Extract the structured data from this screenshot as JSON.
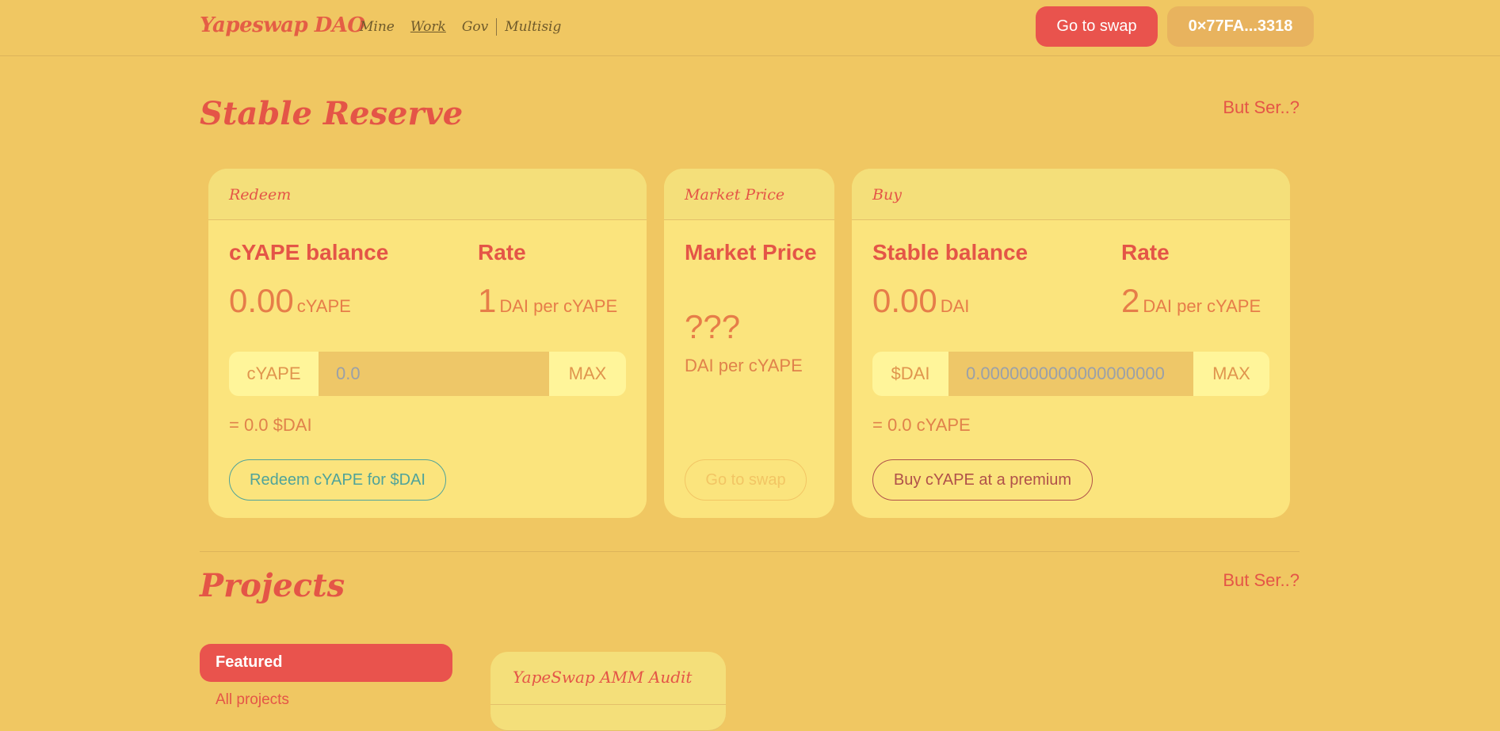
{
  "header": {
    "brand": "Yapeswap DAO",
    "nav": [
      "Mine",
      "Work",
      "Gov",
      "Multisig"
    ],
    "active_nav": "Work",
    "swap_button": "Go to swap",
    "wallet": "0×77FA...3318"
  },
  "stable_reserve": {
    "title": "Stable Reserve",
    "but_ser": "But Ser..?",
    "redeem": {
      "header": "Redeem",
      "balance_label": "cYAPE balance",
      "balance_value": "0.00",
      "balance_unit": "cYAPE",
      "rate_label": "Rate",
      "rate_value": "1",
      "rate_unit": "DAI per cYAPE",
      "input_prefix": "cYAPE",
      "input_value": "0.0",
      "input_max": "MAX",
      "equals": "= 0.0 $DAI",
      "action": "Redeem cYAPE for $DAI"
    },
    "market": {
      "header": "Market Price",
      "label": "Market Price",
      "value": "???",
      "unit": "DAI per cYAPE",
      "action": "Go to swap"
    },
    "buy": {
      "header": "Buy",
      "balance_label": "Stable balance",
      "balance_value": "0.00",
      "balance_unit": "DAI",
      "rate_label": "Rate",
      "rate_value": "2",
      "rate_unit": "DAI per cYAPE",
      "input_prefix": "$DAI",
      "input_value": "0.0000000000000000000",
      "input_max": "MAX",
      "equals": "= 0.0 cYAPE",
      "action": "Buy cYAPE at a premium"
    }
  },
  "projects": {
    "title": "Projects",
    "but_ser": "But Ser..?",
    "filters": [
      "Featured",
      "All projects"
    ],
    "cards": [
      {
        "title": "YapeSwap AMM Audit"
      }
    ]
  }
}
